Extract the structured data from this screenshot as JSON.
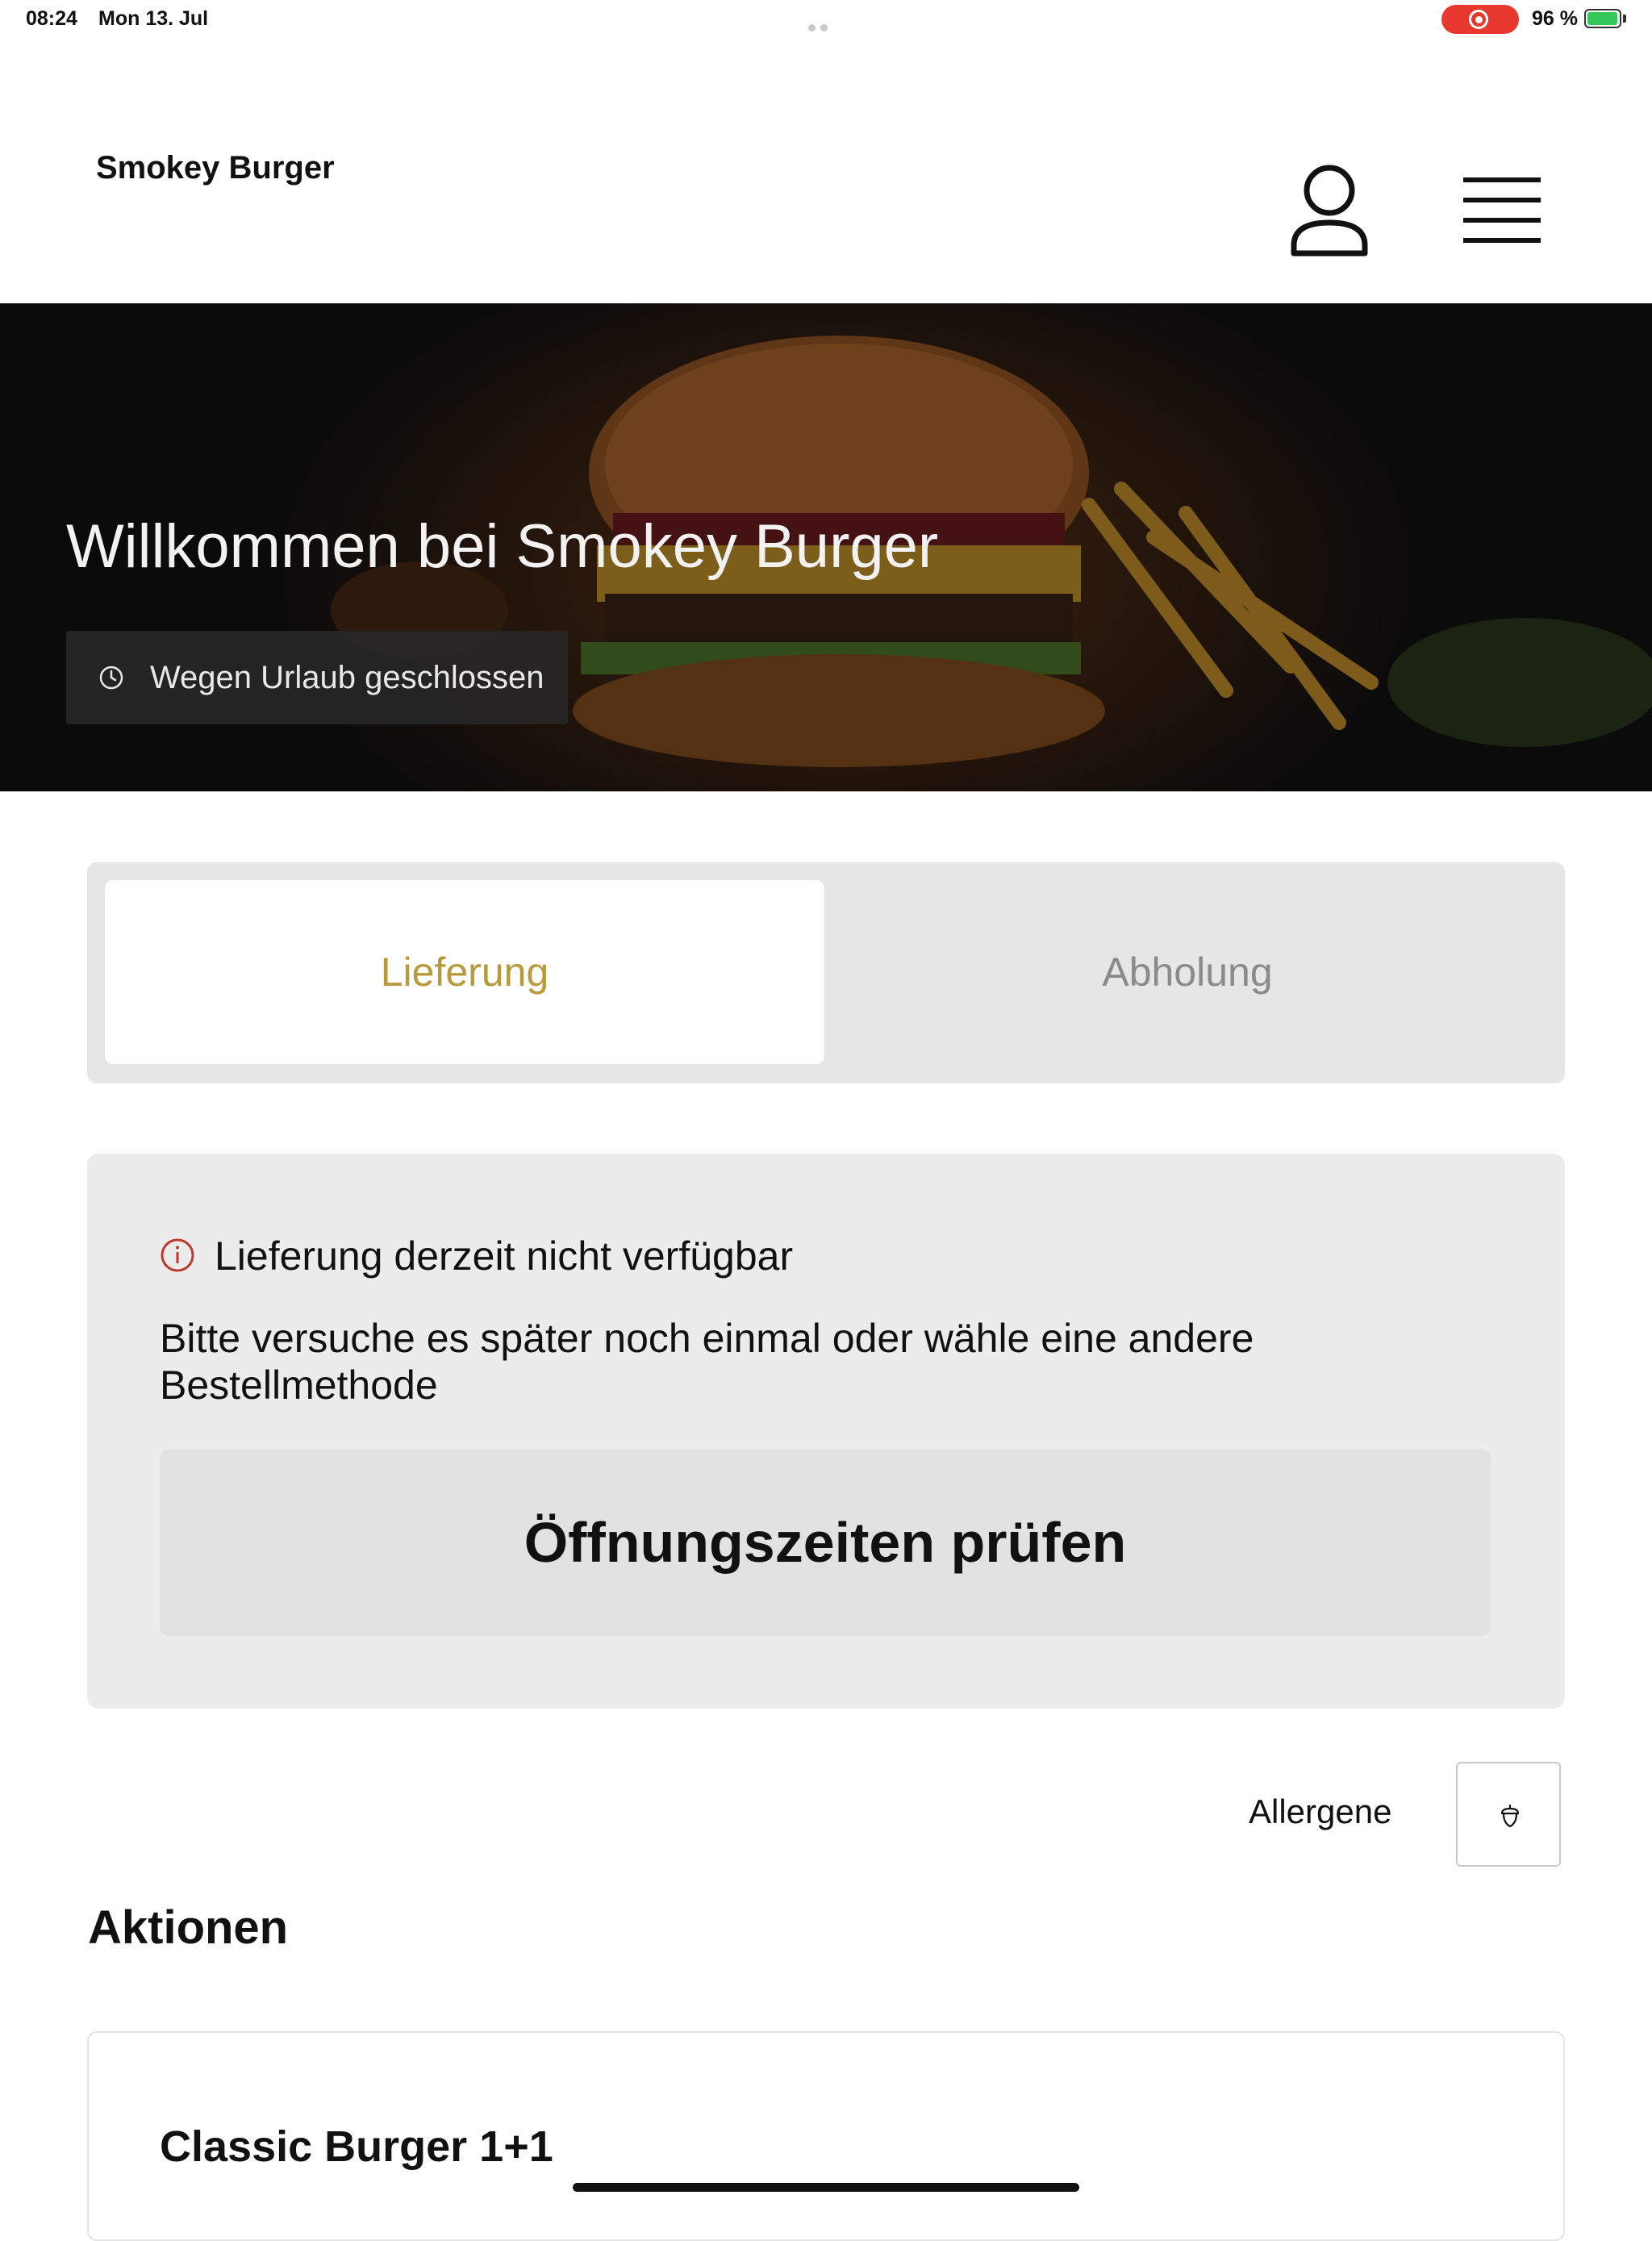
{
  "status_bar": {
    "time": "08:24",
    "date": "Mon 13. Jul",
    "battery": "96 %"
  },
  "header": {
    "brand": "Smokey Burger"
  },
  "hero": {
    "title": "Willkommen bei Smokey Burger",
    "status_badge": "Wegen Urlaub geschlossen"
  },
  "order_tabs": [
    {
      "label": "Lieferung",
      "selected": true
    },
    {
      "label": "Abholung",
      "selected": false
    }
  ],
  "notice": {
    "title": "Lieferung derzeit nicht verfügbar",
    "body": "Bitte versuche es später noch einmal oder wähle eine andere Bestellmethode",
    "button": "Öffnungszeiten prüfen"
  },
  "allergens": {
    "label": "Allergene"
  },
  "section": {
    "title": "Aktionen"
  },
  "cards": [
    {
      "title": "Classic Burger 1+1"
    }
  ],
  "colors": {
    "accent": "#b89a3a",
    "alert": "#c0392b",
    "recording": "#e8372c"
  }
}
